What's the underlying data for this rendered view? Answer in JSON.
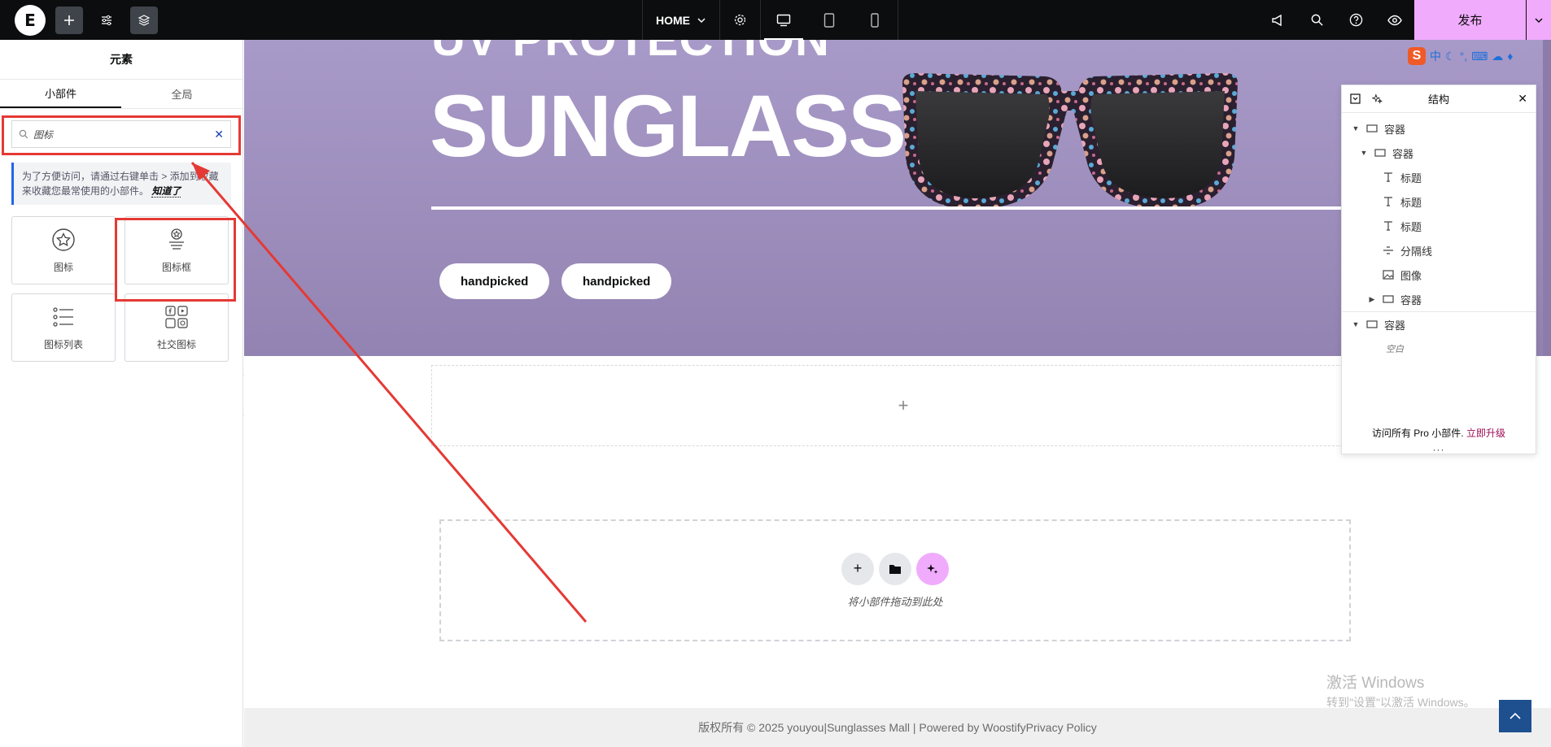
{
  "topbar": {
    "home_label": "HOME",
    "publish_label": "发布"
  },
  "panel": {
    "title": "元素",
    "tabs": [
      {
        "label": "小部件"
      },
      {
        "label": "全局"
      }
    ],
    "search": {
      "value": "图标"
    },
    "tip": {
      "text": "为了方便访问，请通过右键单击 > 添加到收藏来收藏您最常使用的小部件。",
      "link": "知道了"
    },
    "widgets": [
      {
        "label": "图标",
        "icon": "star-circle-icon"
      },
      {
        "label": "图标框",
        "icon": "icon-box-icon"
      },
      {
        "label": "图标列表",
        "icon": "icon-list-icon"
      },
      {
        "label": "社交图标",
        "icon": "social-icons-icon"
      }
    ]
  },
  "canvas": {
    "hero_small": "UV PROTECTION",
    "hero_big": "SUNGLASS",
    "pills": [
      "handpicked",
      "handpicked"
    ],
    "empty_plus": "+",
    "dropzone_text": "将小部件拖动到此处",
    "footer": "版权所有 © 2025 youyou|Sunglasses Mall | Powered by WoostifyPrivacy Policy",
    "watermark_line1": "激活 Windows",
    "watermark_line2": "转到\"设置\"以激活 Windows。"
  },
  "ime": {
    "logo": "S",
    "mode": "中"
  },
  "structure": {
    "title": "结构",
    "items": [
      {
        "label": "容器",
        "level": 0,
        "caret": "down",
        "icon": "container-icon"
      },
      {
        "label": "容器",
        "level": 1,
        "caret": "down",
        "icon": "container-icon"
      },
      {
        "label": "标题",
        "level": 2,
        "caret": "none",
        "icon": "heading-icon"
      },
      {
        "label": "标题",
        "level": 2,
        "caret": "none",
        "icon": "heading-icon"
      },
      {
        "label": "标题",
        "level": 2,
        "caret": "none",
        "icon": "heading-icon"
      },
      {
        "label": "分隔线",
        "level": 2,
        "caret": "none",
        "icon": "divider-icon"
      },
      {
        "label": "图像",
        "level": 2,
        "caret": "none",
        "icon": "image-icon"
      },
      {
        "label": "容器",
        "level": 2,
        "caret": "right",
        "icon": "container-icon"
      },
      {
        "label": "容器",
        "level": 0,
        "caret": "down",
        "icon": "container-icon"
      }
    ],
    "empty_label": "空白",
    "pro_text": "访问所有 Pro 小部件.",
    "pro_link": "立即升级",
    "more": "···"
  },
  "colors": {
    "topbar_bg": "#0c0d0e",
    "publish_bg": "#f0abfc",
    "hero_bg": "#a89ac8",
    "highlight": "#e53935",
    "upgrade_link": "#9b0d54"
  }
}
